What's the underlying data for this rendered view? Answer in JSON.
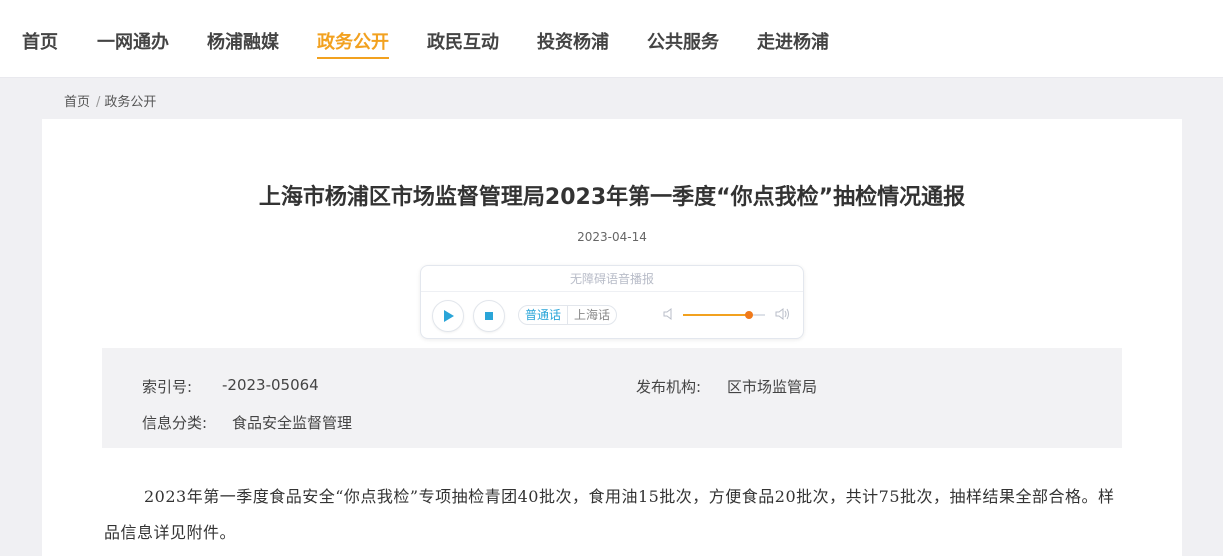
{
  "nav": {
    "items": [
      "首页",
      "一网通办",
      "杨浦融媒",
      "政务公开",
      "政民互动",
      "投资杨浦",
      "公共服务",
      "走进杨浦"
    ],
    "active": "政务公开",
    "accent_color": "#f2a11f"
  },
  "breadcrumb": {
    "home": "首页",
    "separator": "/",
    "current": "政务公开"
  },
  "article": {
    "title": "上海市杨浦区市场监督管理局2023年第一季度“你点我检”抽检情况通报",
    "date": "2023-04-14"
  },
  "player": {
    "title": "无障碍语音播报",
    "lang_mandarin": "普通话",
    "lang_shanghai": "上海话",
    "active_lang": "普通话",
    "volume_level": 0.8,
    "icons": {
      "play": "play-icon",
      "stop": "stop-icon",
      "vol_low": "volume-low-icon",
      "vol_high": "volume-high-icon"
    }
  },
  "meta": {
    "index_label": "索引号:",
    "index_value": "-2023-05064",
    "org_label": "发布机构:",
    "org_value": "区市场监管局",
    "category_label": "信息分类:",
    "category_value": "食品安全监督管理"
  },
  "body": {
    "paragraph": "2023年第一季度食品安全“你点我检”专项抽检青团40批次，食用油15批次，方便食品20批次，共计75批次，抽样结果全部合格。样品信息详见附件。"
  }
}
